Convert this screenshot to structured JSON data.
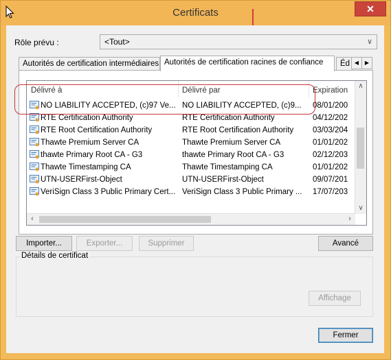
{
  "window": {
    "title": "Certificats",
    "close_label": "✕"
  },
  "role": {
    "label": "Rôle prévu :",
    "value": "<Tout>"
  },
  "tabs": [
    {
      "label": "Autorités de certification intermédiaires"
    },
    {
      "label": "Autorités de certification racines de confiance"
    },
    {
      "label": "Éd"
    }
  ],
  "columns": {
    "issued_to": "Délivré à",
    "issued_by": "Délivré par",
    "expiration": "Expiration"
  },
  "rows": [
    {
      "to": "NO LIABILITY ACCEPTED, (c)97 Ve...",
      "by": "NO LIABILITY ACCEPTED, (c)9...",
      "exp": "08/01/200"
    },
    {
      "to": "RTE Certification Authority",
      "by": "RTE Certification Authority",
      "exp": "04/12/202"
    },
    {
      "to": "RTE Root Certification Authority",
      "by": "RTE Root Certification Authority",
      "exp": "03/03/204"
    },
    {
      "to": "Thawte Premium Server CA",
      "by": "Thawte Premium Server CA",
      "exp": "01/01/202"
    },
    {
      "to": "thawte Primary Root CA - G3",
      "by": "thawte Primary Root CA - G3",
      "exp": "02/12/203"
    },
    {
      "to": "Thawte Timestamping CA",
      "by": "Thawte Timestamping CA",
      "exp": "01/01/202"
    },
    {
      "to": "UTN-USERFirst-Object",
      "by": "UTN-USERFirst-Object",
      "exp": "09/07/201"
    },
    {
      "to": "VeriSign Class 3 Public Primary Cert...",
      "by": "VeriSign Class 3 Public Primary ...",
      "exp": "17/07/203"
    }
  ],
  "buttons": {
    "import": "Importer...",
    "export": "Exporter...",
    "remove": "Supprimer",
    "advanced": "Avancé",
    "view": "Affichage",
    "close": "Fermer"
  },
  "details": {
    "label": "Détails de certificat"
  },
  "colors": {
    "title_bar": "#f2b656",
    "close_button": "#c9453a",
    "highlight": "#c8333a"
  }
}
